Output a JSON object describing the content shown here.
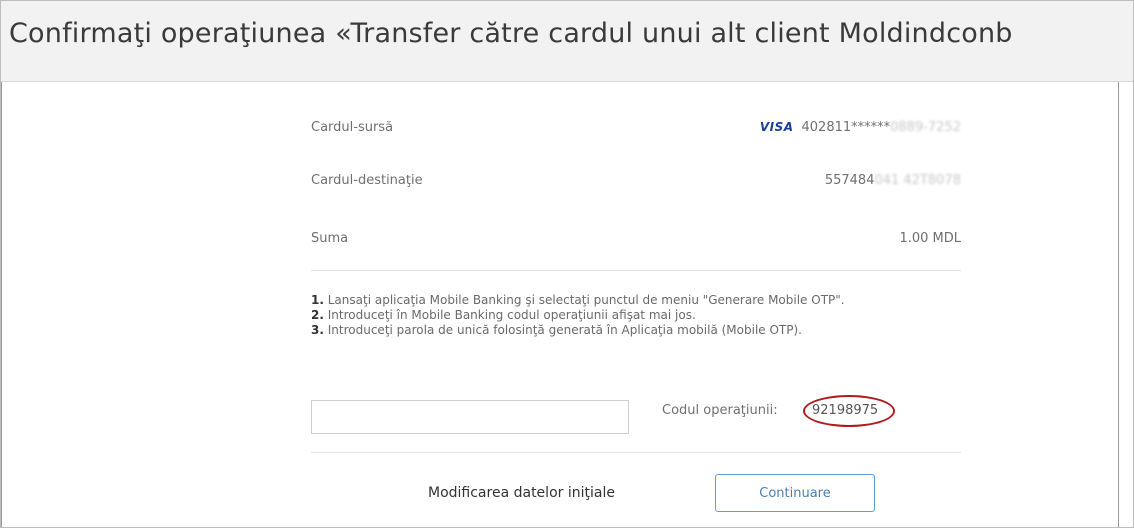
{
  "header": {
    "title": "Confirmaţi operaţiunea «Transfer către cardul unui alt client Moldindconb"
  },
  "details": {
    "source_card": {
      "label": "Cardul-sursă",
      "brand": "VISA",
      "number_visible": "402811******",
      "number_blurred": "0889-7252"
    },
    "destination_card": {
      "label": "Cardul-destinaţie",
      "number_visible": "557484",
      "number_blurred": "041 42T8078"
    },
    "amount": {
      "label": "Suma",
      "value": "1.00 MDL"
    }
  },
  "instructions": {
    "step1_num": "1.",
    "step1_text": "Lansaţi aplicaţia Mobile Banking şi selectaţi punctul de meniu \"Generare Mobile OTP\".",
    "step2_num": "2.",
    "step2_text": "Introduceţi în Mobile Banking codul operaţiunii afişat mai jos.",
    "step3_num": "3.",
    "step3_text": "Introduceţi parola de unică folosinţă generată în Aplicaţia mobilă (Mobile OTP)."
  },
  "otp": {
    "input_value": "",
    "code_label": "Codul operaţiunii:",
    "code_value": "92198975"
  },
  "actions": {
    "modify_label": "Modificarea datelor iniţiale",
    "continue_label": "Continuare"
  },
  "colors": {
    "visa_blue": "#1a3f9a",
    "button_border": "#5aa0df",
    "highlight_circle": "#b01c1c"
  }
}
